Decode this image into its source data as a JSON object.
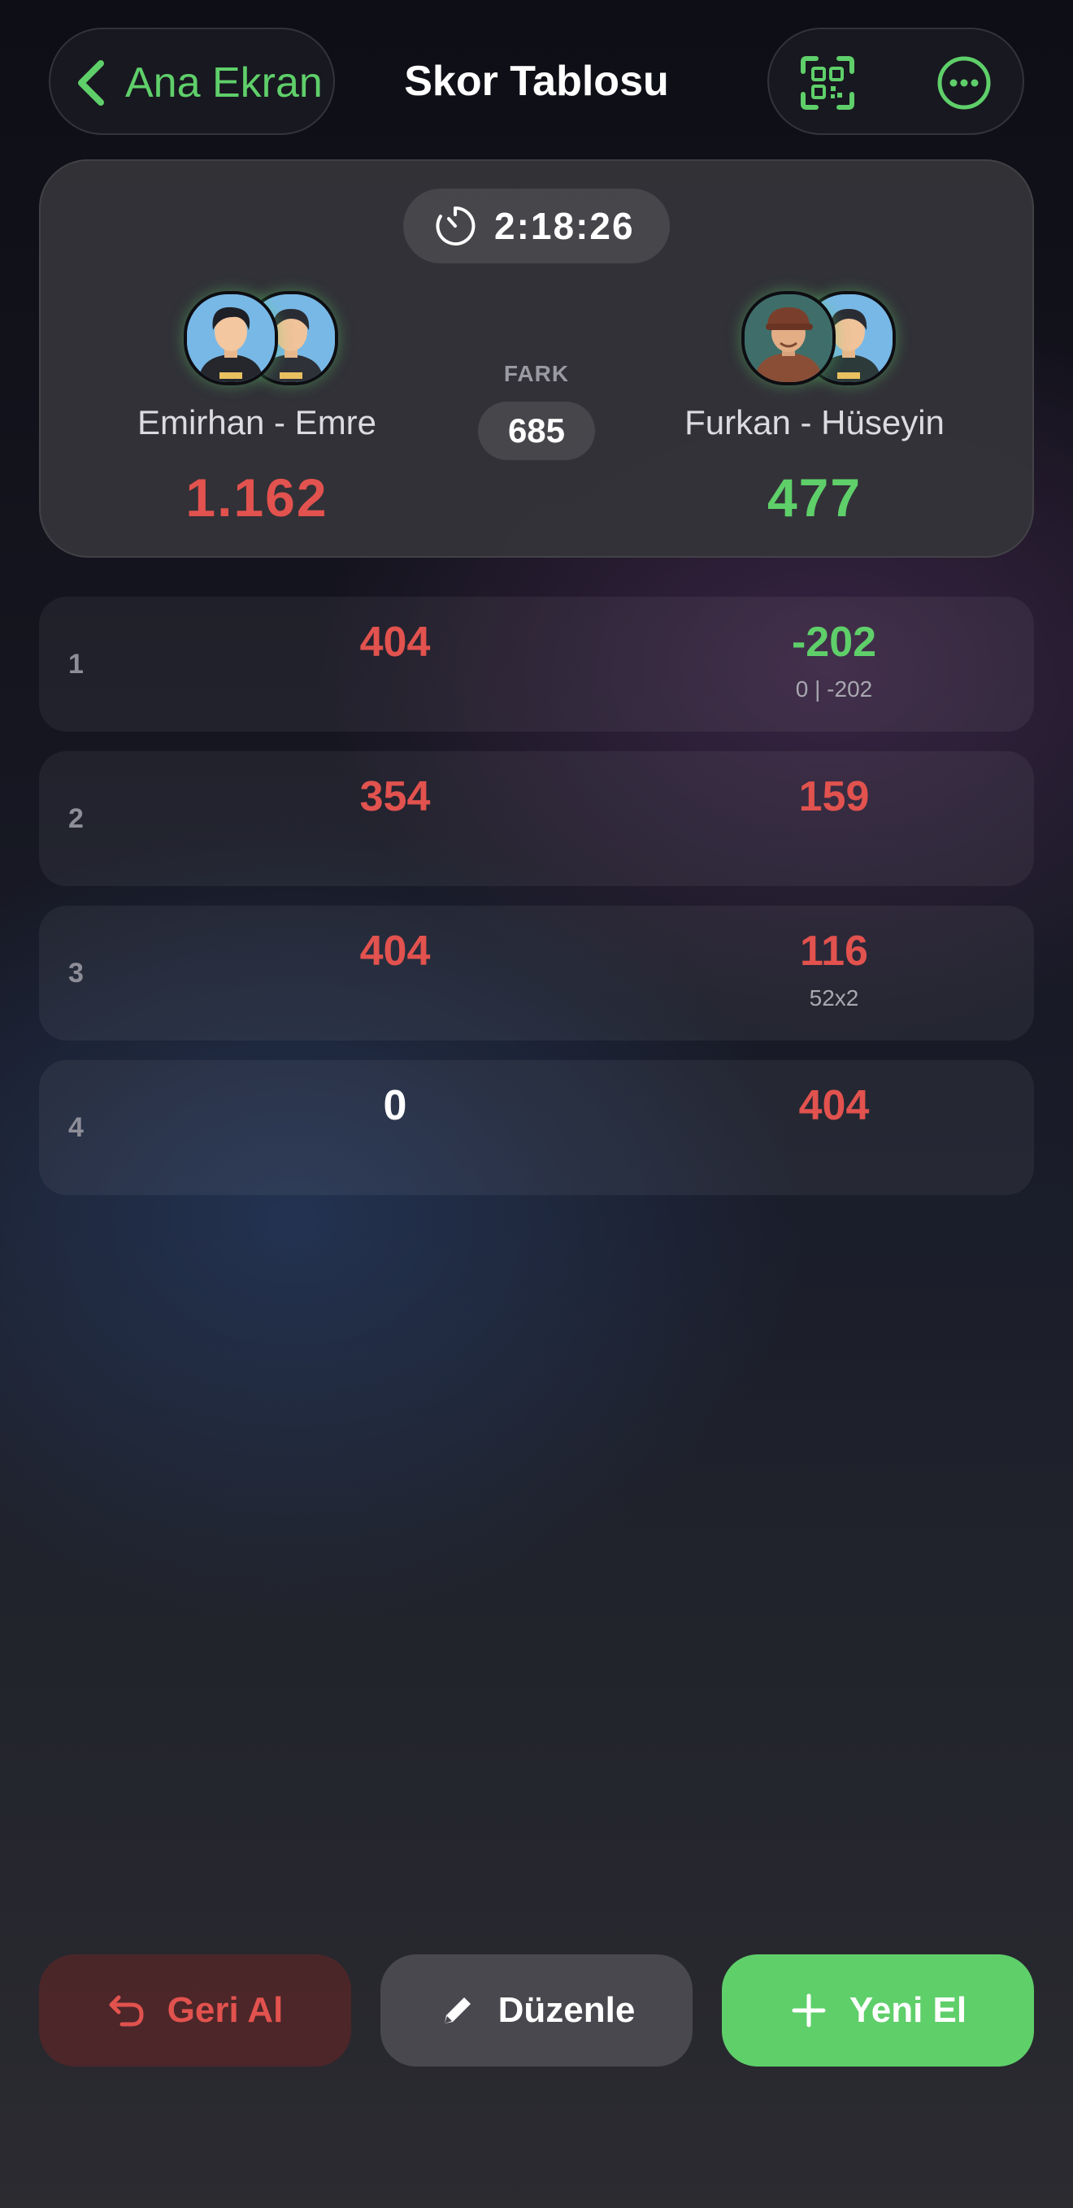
{
  "header": {
    "back_label": "Ana Ekran",
    "title": "Skor Tablosu",
    "icons": [
      "chevron-left-icon",
      "qr-scan-icon",
      "more-icon"
    ]
  },
  "card": {
    "timer": "2:18:26",
    "diff_label": "FARK",
    "diff_value": "685",
    "team1": {
      "name": "Emirhan - Emre",
      "score": "1.162"
    },
    "team2": {
      "name": "Furkan - Hüseyin",
      "score": "477"
    }
  },
  "rounds": [
    {
      "num": "1",
      "team1": "404",
      "team2": "-202",
      "team2_sub": "0 | -202"
    },
    {
      "num": "2",
      "team1": "354",
      "team2": "159",
      "team2_sub": ""
    },
    {
      "num": "3",
      "team1": "404",
      "team2": "116",
      "team2_sub": "52x2"
    },
    {
      "num": "4",
      "team1": "0",
      "team2": "404",
      "team2_sub": ""
    }
  ],
  "actions": {
    "undo": "Geri Al",
    "edit": "Düzenle",
    "new_hand": "Yeni El"
  },
  "colors": {
    "accent_green": "#5fcf6a",
    "accent_red": "#e2524e"
  }
}
